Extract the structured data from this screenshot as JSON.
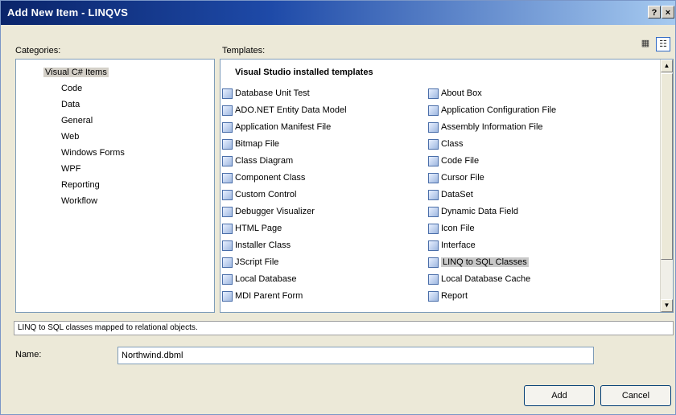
{
  "window": {
    "title": "Add New Item - LINQVS",
    "help_glyph": "?",
    "close_glyph": "×"
  },
  "labels": {
    "categories": "Categories:",
    "templates": "Templates:",
    "name": "Name:"
  },
  "view_buttons": {
    "large_icons_glyph": "▦",
    "small_icons_glyph": "☷"
  },
  "categories": {
    "root": "Visual C# Items",
    "items": [
      "Code",
      "Data",
      "General",
      "Web",
      "Windows Forms",
      "WPF",
      "Reporting",
      "Workflow"
    ]
  },
  "templates": {
    "section_header": "Visual Studio installed templates",
    "left_column": [
      "Database Unit Test",
      "ADO.NET Entity Data Model",
      "Application Manifest File",
      "Bitmap File",
      "Class Diagram",
      "Component Class",
      "Custom Control",
      "Debugger Visualizer",
      "HTML Page",
      "Installer Class",
      "JScript File",
      "Local Database",
      "MDI Parent Form"
    ],
    "right_column": [
      "About Box",
      "Application Configuration File",
      "Assembly Information File",
      "Class",
      "Code File",
      "Cursor File",
      "DataSet",
      "Dynamic Data Field",
      "Icon File",
      "Interface",
      "LINQ to SQL Classes",
      "Local Database Cache",
      "Report"
    ],
    "selected": "LINQ to SQL Classes"
  },
  "scrollbar": {
    "up_glyph": "▲",
    "down_glyph": "▼"
  },
  "description": "LINQ to SQL classes mapped to relational objects.",
  "name_field": {
    "value": "Northwind.dbml"
  },
  "buttons": {
    "add": "Add",
    "cancel": "Cancel"
  }
}
